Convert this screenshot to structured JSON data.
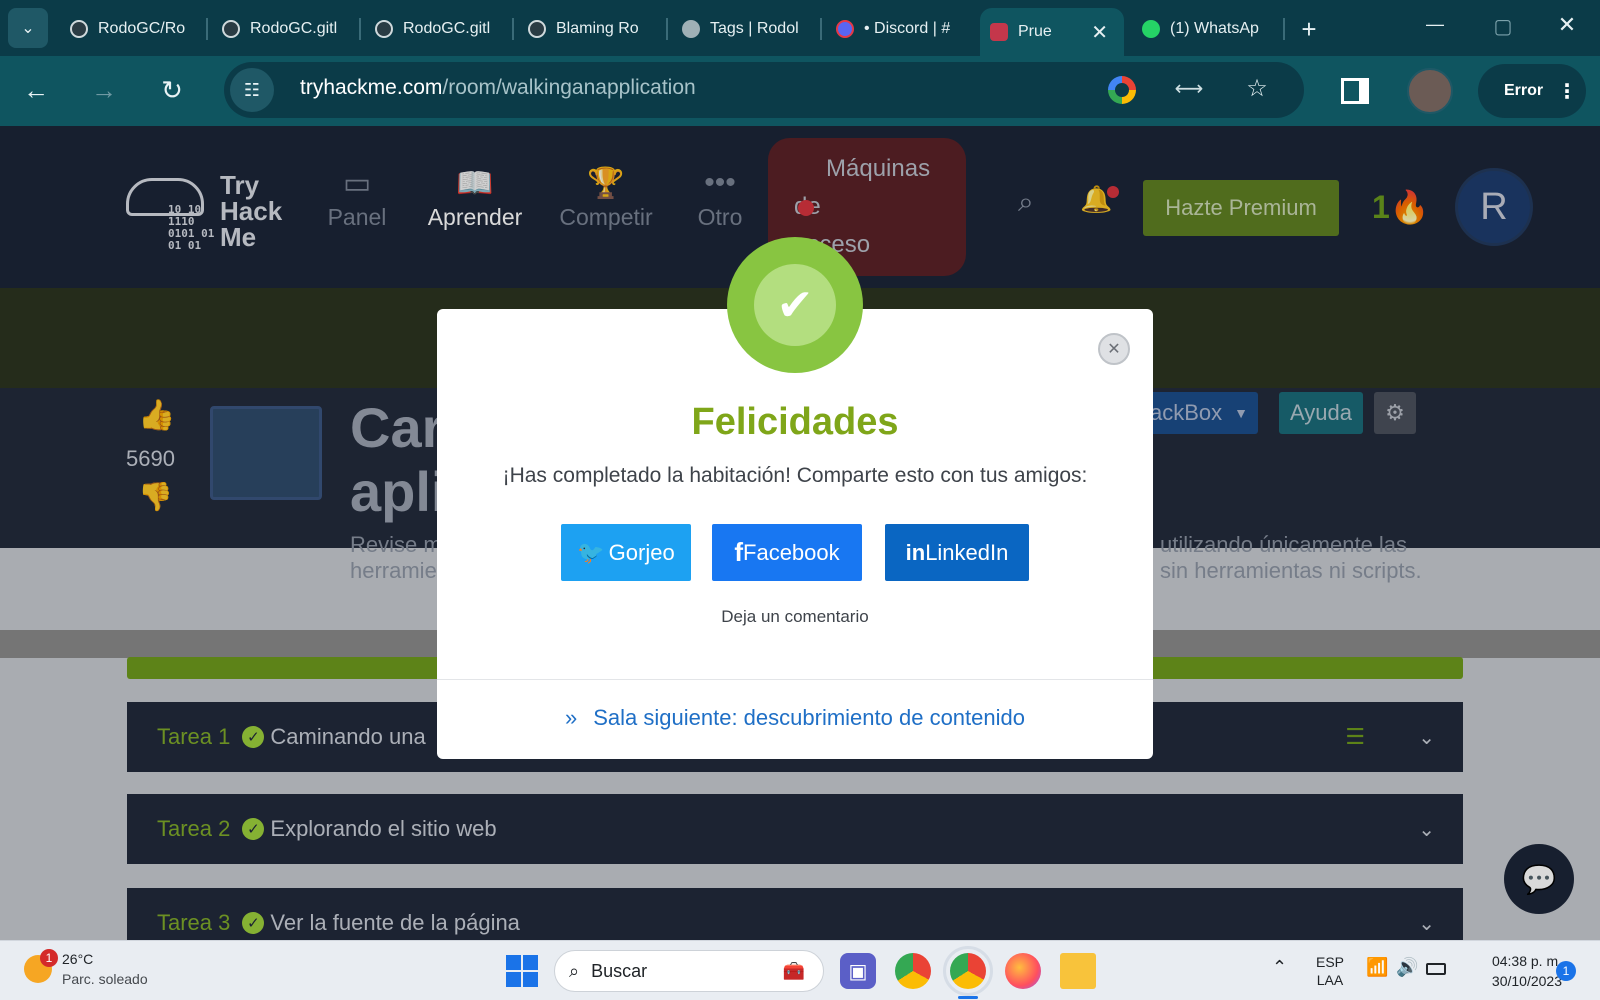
{
  "browser": {
    "tabs": [
      {
        "title": "RodoGC/Ro",
        "favicon": "github-icon"
      },
      {
        "title": "RodoGC.gitl",
        "favicon": "github-icon"
      },
      {
        "title": "RodoGC.gitl",
        "favicon": "github-icon"
      },
      {
        "title": "Blaming Ro",
        "favicon": "github-icon"
      },
      {
        "title": "Tags | Rodol",
        "favicon": "globe-icon"
      },
      {
        "title": "• Discord | #",
        "favicon": "discord-icon"
      },
      {
        "title": "Prue",
        "favicon": "tryhackme-icon",
        "active": true
      },
      {
        "title": "(1) WhatsAp",
        "favicon": "whatsapp-icon"
      }
    ],
    "url_domain": "tryhackme.com",
    "url_path": "/room/walkinganapplication",
    "profile_status": "Error",
    "accent": "#0f5560"
  },
  "site": {
    "logo_lines": [
      "Try",
      "Hack",
      "Me"
    ],
    "logo_binary": [
      "10 10",
      "1110",
      "0101 01",
      "01 01"
    ],
    "nav": [
      "Panel",
      "Aprender",
      "Competir",
      "Otro"
    ],
    "machines_label": [
      "Máquinas",
      "de",
      "acceso"
    ],
    "premium_label": "Hazte Premium",
    "streak": "1",
    "avatar_letter": "R"
  },
  "room": {
    "title_partial": [
      "Car",
      "apli"
    ],
    "likes": "5690",
    "desc_left": [
      "Revise m",
      "herramie"
    ],
    "desc_right": [
      "utilizando únicamente las",
      "sin herramientas ni scripts."
    ],
    "attackbox_label": "ackBox",
    "help_label": "Ayuda",
    "tasks": [
      {
        "num": "Tarea 1",
        "title": "Caminando una"
      },
      {
        "num": "Tarea 2",
        "title": "Explorando el sitio web"
      },
      {
        "num": "Tarea 3",
        "title": "Ver la fuente de la página"
      }
    ]
  },
  "modal": {
    "title": "Felicidades",
    "message": "¡Has completado la habitación! Comparte esto con tus amigos:",
    "twitter_label": "Gorjeo",
    "facebook_label": "Facebook",
    "linkedin_label": "LinkedIn",
    "comment_link": "Deja un comentario",
    "next_room": "Sala siguiente: descubrimiento de contenido",
    "colors": {
      "title": "#7fa619",
      "twitter": "#1da1f2",
      "facebook": "#1877f2",
      "linkedin": "#0a66c2",
      "badge": "#88c541"
    }
  },
  "taskbar": {
    "weather_temp": "26°C",
    "weather_desc": "Parc. soleado",
    "weather_badge": "1",
    "search_placeholder": "Buscar",
    "lang_top": "ESP",
    "lang_bottom": "LAA",
    "time": "04:38 p. m.",
    "date": "30/10/2023",
    "notif_count": "1"
  }
}
